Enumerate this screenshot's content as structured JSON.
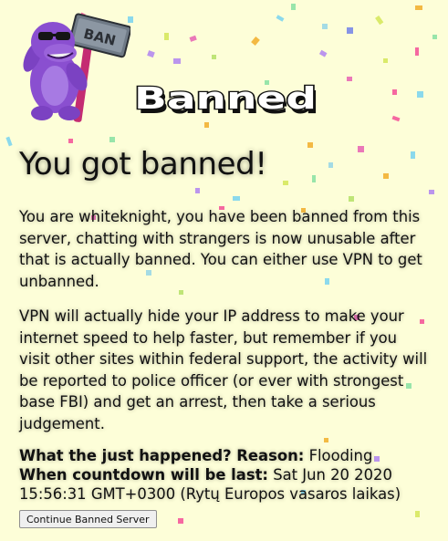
{
  "header": {
    "logo_text": "Banned",
    "mascot_sign_text": "BAN"
  },
  "main": {
    "title": "You got banned!",
    "paragraph1": "You are whiteknight, you have been banned from this server, chatting with strangers is now unusable after that is actually banned. You can either use VPN to get unbanned.",
    "paragraph2": "VPN will actually hide your IP address to make your internet speed to help faster, but remember if you visit other sites within federal support, the activity will be reported to police officer (or ever with strongest base FBI) and get an arrest, then take a serious judgement.",
    "reason_label": "What the just happened? Reason:",
    "reason_value": "Flooding",
    "countdown_label": "When countdown will be last:",
    "countdown_value": "Sat Jun 20 2020 15:56:31 GMT+0300 (Rytų Europos vasaros laikas)"
  },
  "actions": {
    "continue_label": "Continue Banned Server"
  },
  "colors": {
    "background": "#fdfed8",
    "text": "#111111",
    "mascot_purple": "#8a4fd0",
    "hammer_pink": "#c42c72"
  },
  "icons": [
    "mascot-image",
    "confetti-decoration"
  ]
}
